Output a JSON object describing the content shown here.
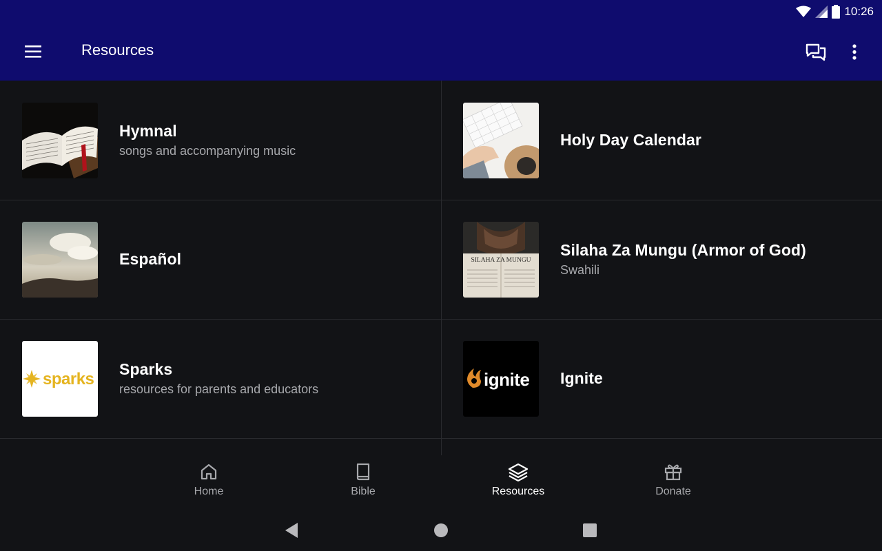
{
  "status_bar": {
    "time": "10:26"
  },
  "app_bar": {
    "title": "Resources"
  },
  "resources": [
    {
      "title": "Hymnal",
      "subtitle": "songs and accompanying music"
    },
    {
      "title": "Holy Day Calendar",
      "subtitle": ""
    },
    {
      "title": "Español",
      "subtitle": ""
    },
    {
      "title": "Silaha Za Mungu (Armor of God)",
      "subtitle": "Swahili",
      "thumb_caption": "SILAHA ZA MUNGU"
    },
    {
      "title": "Sparks",
      "subtitle": "resources for parents and educators",
      "thumb_caption": "sparks"
    },
    {
      "title": "Ignite",
      "subtitle": "",
      "thumb_caption": "ignite"
    }
  ],
  "bottom_nav": [
    {
      "label": "Home",
      "icon": "home-icon",
      "active": false
    },
    {
      "label": "Bible",
      "icon": "book-icon",
      "active": false
    },
    {
      "label": "Resources",
      "icon": "layers-icon",
      "active": true
    },
    {
      "label": "Donate",
      "icon": "gift-icon",
      "active": false
    }
  ],
  "colors": {
    "app_bar": "#0f0c6e",
    "background": "#121316",
    "secondary_text": "#a7a8ac",
    "sparks_yellow": "#e5b420",
    "ignite_orange": "#e08a2a"
  }
}
